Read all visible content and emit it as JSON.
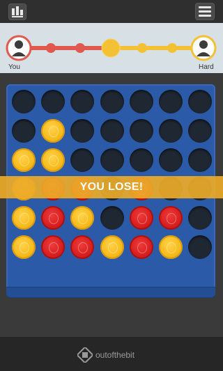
{
  "header": {
    "logo_icon": "app-logo-icon",
    "menu_icon": "hamburger-menu-icon"
  },
  "progress": {
    "left_player": "You",
    "right_player": "Hard",
    "colors": {
      "red": "#e0584e",
      "yellow": "#f4c135",
      "avatar_bg": "#ffffff"
    }
  },
  "board": {
    "rows": [
      [
        "empty",
        "empty",
        "empty",
        "empty",
        "empty",
        "empty",
        "empty"
      ],
      [
        "empty",
        "yellow",
        "empty",
        "empty",
        "empty",
        "empty",
        "empty"
      ],
      [
        "yellow",
        "yellow",
        "empty",
        "empty",
        "empty",
        "empty",
        "empty"
      ],
      [
        "yellow",
        "red",
        "red",
        "empty",
        "red",
        "empty",
        "empty"
      ],
      [
        "yellow",
        "red",
        "yellow",
        "empty",
        "red",
        "red",
        "empty"
      ],
      [
        "yellow",
        "red",
        "red",
        "yellow",
        "red",
        "yellow",
        "empty"
      ]
    ],
    "colors": {
      "board": "#2a5aa8",
      "empty": "#1f2733",
      "yellow": "#f7bb1c",
      "red": "#d81f1f"
    }
  },
  "result": {
    "message": "YOU LOSE!"
  },
  "footer": {
    "brand": "outofthebit",
    "brand_icon": "outofthebit-logo-icon"
  }
}
